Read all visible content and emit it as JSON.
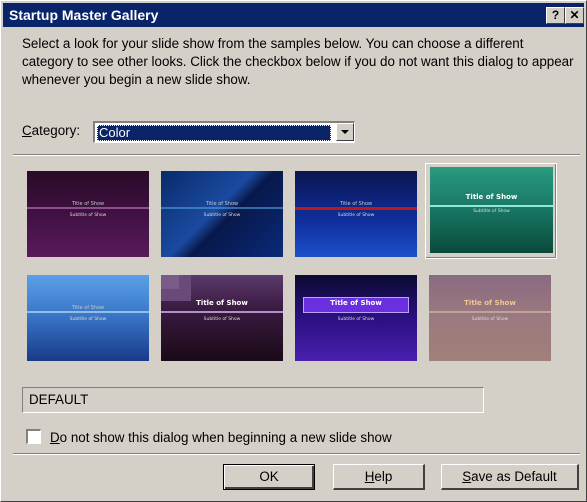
{
  "window": {
    "title": "Startup Master Gallery",
    "help_glyph": "?",
    "close_glyph": "✕"
  },
  "intro_text": "Select a look for your slide show from the samples below.  You can choose a different category to see other looks.  Click the checkbox below if you do not want this dialog to appear whenever you begin a new slide show.",
  "category": {
    "label_accel": "C",
    "label_rest": "ategory:",
    "selected": "Color"
  },
  "thumbnails": [
    {
      "title": "Title of Show",
      "subtitle": "Subtitle of Show",
      "style": "dark-purple"
    },
    {
      "title": "Title of Show",
      "subtitle": "Subtitle of Show",
      "style": "blue-diagonal"
    },
    {
      "title": "Title of Show",
      "subtitle": "Subtitle of Show",
      "style": "navy-red-line"
    },
    {
      "title": "Title of Show",
      "subtitle": "Subtitle of Show",
      "style": "teal-selected"
    },
    {
      "title": "Title of Show",
      "subtitle": "Subtitle of Show",
      "style": "sky-blue"
    },
    {
      "title": "Title of Show",
      "subtitle": "Subtitle of Show",
      "style": "plum-steps"
    },
    {
      "title": "Title of Show",
      "subtitle": "Subtitle of Show",
      "style": "violet-banner"
    },
    {
      "title": "Title of Show",
      "subtitle": "Subtitle of Show",
      "style": "dusty-rose"
    }
  ],
  "selected_index": 3,
  "selected_name": "DEFAULT",
  "checkbox": {
    "checked": false,
    "label_accel": "D",
    "label_rest": "o not show this dialog when beginning a new slide show"
  },
  "buttons": {
    "ok": "OK",
    "help_accel": "H",
    "help_rest": "elp",
    "save_accel": "S",
    "save_rest": "ave as Default"
  },
  "colors": {
    "titlebar": "#0a246a",
    "dialog_bg": "#d4d0c8"
  }
}
